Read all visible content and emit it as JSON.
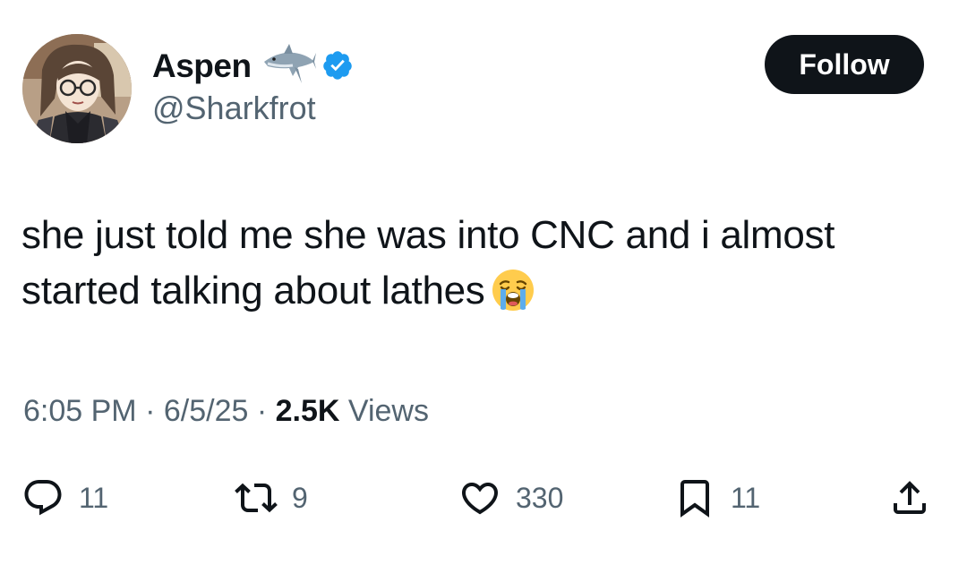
{
  "author": {
    "display_name": "Aspen",
    "handle": "@Sharkfrot",
    "badge_icon": "shark-icon",
    "verified_icon": "verified-badge-icon",
    "verified_color": "#1d9bf0"
  },
  "follow_button": {
    "label": "Follow"
  },
  "tweet": {
    "text": "she just told me she was into CNC and i almost started talking about lathes",
    "emoji_icon": "loudly-crying-face-icon"
  },
  "meta": {
    "time": "6:05 PM",
    "separator": "·",
    "date": "6/5/25",
    "views_count": "2.5K",
    "views_label": "Views"
  },
  "actions": {
    "reply": {
      "icon": "reply-icon",
      "count": "11"
    },
    "repost": {
      "icon": "repost-icon",
      "count": "9"
    },
    "like": {
      "icon": "heart-icon",
      "count": "330"
    },
    "bookmark": {
      "icon": "bookmark-icon",
      "count": "11"
    },
    "share": {
      "icon": "share-icon"
    }
  },
  "colors": {
    "text": "#0f1419",
    "secondary_text": "#536471",
    "button_bg": "#0f1419",
    "button_text": "#ffffff"
  }
}
